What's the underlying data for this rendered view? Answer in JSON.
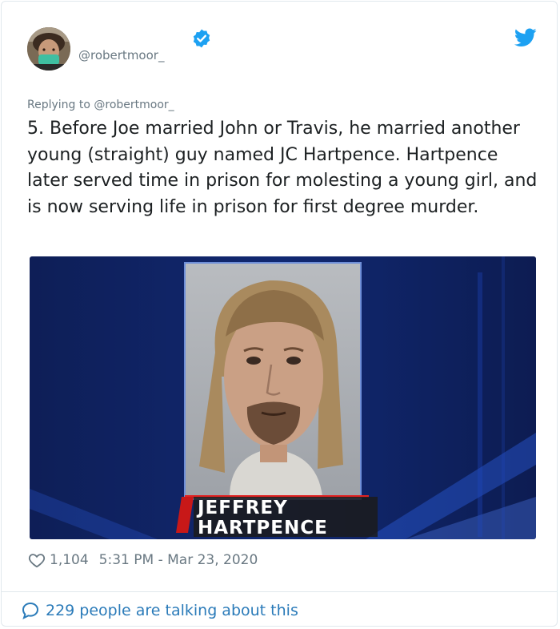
{
  "tweet": {
    "handle": "@robertmoor_",
    "replying_to": "Replying to @robertmoor_",
    "text": "5. Before Joe married John or Travis, he married another young (straight) guy named JC Hartpence. Hartpence later served time in prison for molesting a young girl, and is now serving life in prison for first degree murder.",
    "likes": "1,104",
    "timestamp": "5:31 PM - Mar 23, 2020",
    "talking_about": "229 people are talking about this"
  },
  "media": {
    "caption_line1": "JEFFREY",
    "caption_line2": "HARTPENCE"
  },
  "icons": {
    "verified": "verified-badge-icon",
    "brand": "twitter-bird-icon",
    "like": "heart-icon",
    "reply": "speech-bubble-icon"
  },
  "colors": {
    "brand_blue": "#1da1f2",
    "link_blue": "#2b7bb9",
    "muted": "#697882",
    "text": "#1c2022"
  }
}
